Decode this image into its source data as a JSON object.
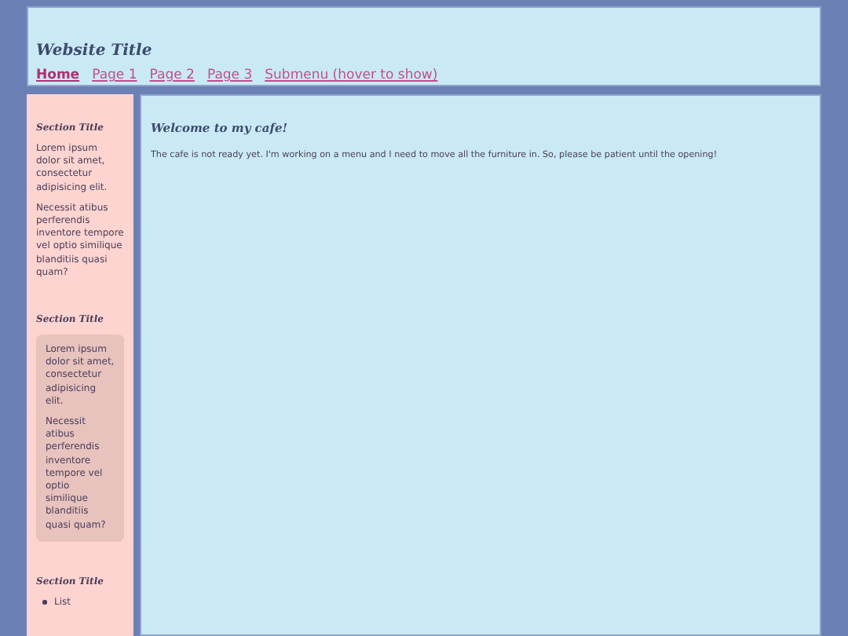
{
  "header": {
    "title": "Website Title",
    "nav": [
      {
        "label": "Home",
        "selected": true
      },
      {
        "label": "Page 1",
        "selected": false
      },
      {
        "label": "Page 2",
        "selected": false
      },
      {
        "label": "Page 3",
        "selected": false
      },
      {
        "label": "Submenu (hover to show)",
        "selected": false
      }
    ]
  },
  "sidebar": {
    "sections": [
      {
        "kind": "text",
        "title": "Section Title",
        "paragraphs": [
          "Lorem ipsum dolor sit amet, consectetur adipisicing elit.",
          "Necessit atibus perferendis inventore tempore vel optio similique blanditiis quasi quam?"
        ]
      },
      {
        "kind": "box",
        "title": "Section Title",
        "paragraphs": [
          "Lorem ipsum dolor sit amet, consectetur adipisicing elit.",
          "Necessit atibus perferendis inventore tempore vel optio similique blanditiis quasi quam?"
        ]
      },
      {
        "kind": "list",
        "title": "Section Title",
        "items": [
          "List"
        ]
      }
    ]
  },
  "main": {
    "heading": "Welcome to my cafe!",
    "text": "The cafe is not ready yet. I'm working on a menu and I need to move all the furniture in. So, please be patient until the opening!"
  }
}
